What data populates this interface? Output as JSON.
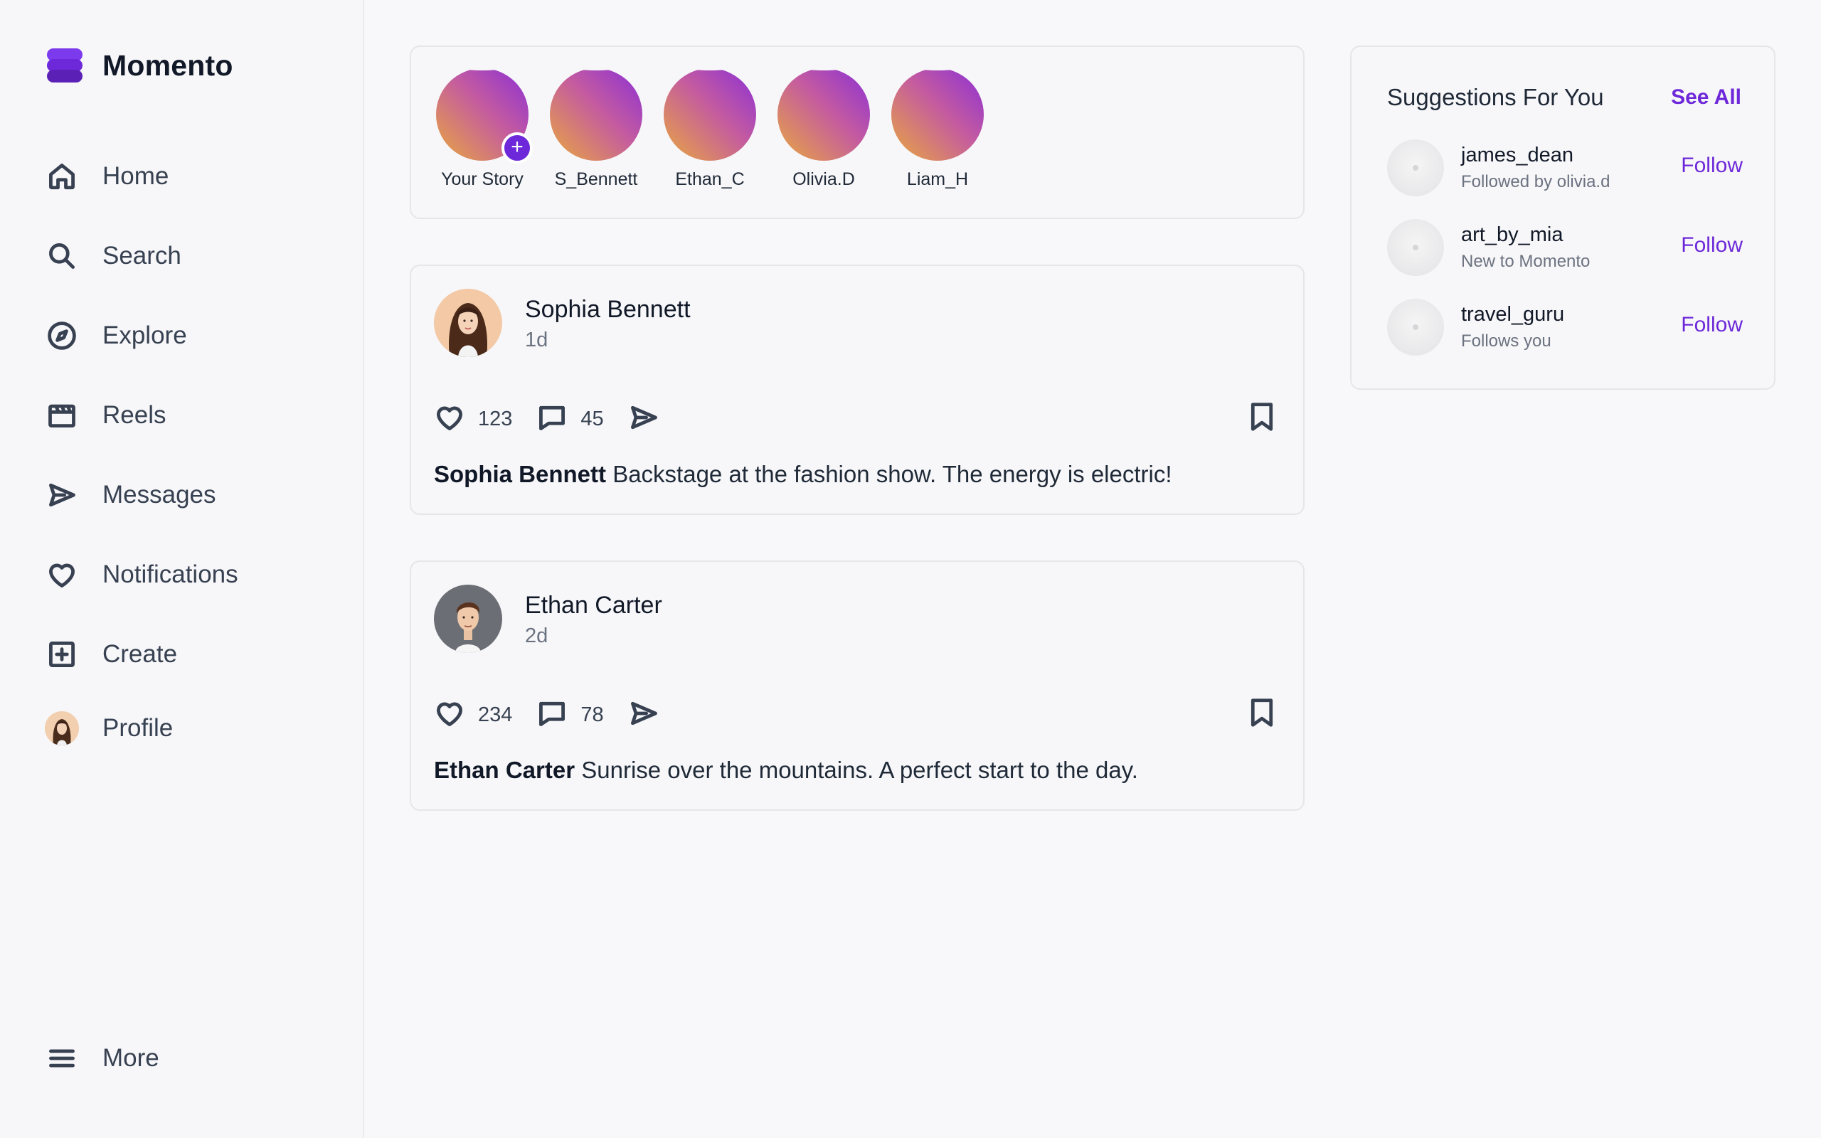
{
  "app": {
    "name": "Momento",
    "accent_color": "#6d28d9"
  },
  "sidebar": {
    "items": [
      {
        "label": "Home",
        "icon": "home-icon"
      },
      {
        "label": "Search",
        "icon": "search-icon"
      },
      {
        "label": "Explore",
        "icon": "compass-icon"
      },
      {
        "label": "Reels",
        "icon": "clapperboard-icon"
      },
      {
        "label": "Messages",
        "icon": "send-icon"
      },
      {
        "label": "Notifications",
        "icon": "heart-icon"
      },
      {
        "label": "Create",
        "icon": "plus-square-icon"
      },
      {
        "label": "Profile",
        "icon": "avatar"
      }
    ],
    "more": {
      "label": "More",
      "icon": "menu-icon"
    }
  },
  "stories": [
    {
      "label": "Your Story",
      "is_own": true
    },
    {
      "label": "S_Bennett"
    },
    {
      "label": "Ethan_C"
    },
    {
      "label": "Olivia.D"
    },
    {
      "label": "Liam_H"
    }
  ],
  "posts": [
    {
      "author": "Sophia Bennett",
      "time": "1d",
      "likes": "123",
      "comments": "45",
      "caption_author": "Sophia Bennett",
      "caption_text": "Backstage at the fashion show. The energy is electric!"
    },
    {
      "author": "Ethan Carter",
      "time": "2d",
      "likes": "234",
      "comments": "78",
      "caption_author": "Ethan Carter",
      "caption_text": "Sunrise over the mountains. A perfect start to the day."
    }
  ],
  "suggestions": {
    "title": "Suggestions For You",
    "see_all": "See All",
    "items": [
      {
        "username": "james_dean",
        "subtitle": "Followed by olivia.d",
        "action": "Follow"
      },
      {
        "username": "art_by_mia",
        "subtitle": "New to Momento",
        "action": "Follow"
      },
      {
        "username": "travel_guru",
        "subtitle": "Follows you",
        "action": "Follow"
      }
    ]
  }
}
